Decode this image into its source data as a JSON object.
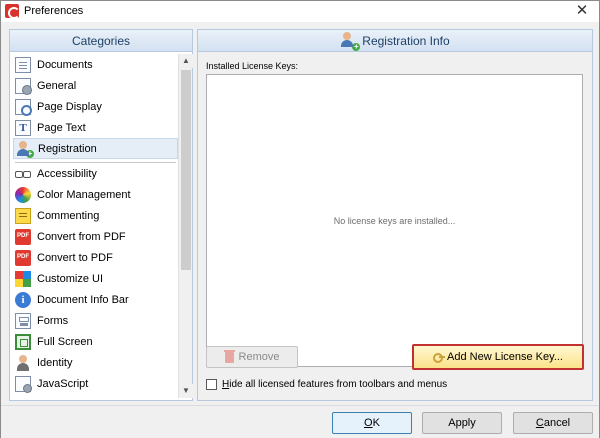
{
  "window": {
    "title": "Preferences",
    "close_glyph": "✕"
  },
  "categories": {
    "header": "Categories",
    "items": [
      {
        "label": "Documents",
        "icon": "document-icon"
      },
      {
        "label": "General",
        "icon": "general-settings-icon"
      },
      {
        "label": "Page Display",
        "icon": "page-display-icon"
      },
      {
        "label": "Page Text",
        "icon": "page-text-icon"
      },
      {
        "label": "Registration",
        "icon": "registration-icon",
        "selected": true
      },
      {
        "label": "Accessibility",
        "icon": "accessibility-glasses-icon"
      },
      {
        "label": "Color Management",
        "icon": "color-wheel-icon"
      },
      {
        "label": "Commenting",
        "icon": "comment-note-icon"
      },
      {
        "label": "Convert from PDF",
        "icon": "convert-from-pdf-icon"
      },
      {
        "label": "Convert to PDF",
        "icon": "convert-to-pdf-icon"
      },
      {
        "label": "Customize UI",
        "icon": "customize-ui-icon"
      },
      {
        "label": "Document Info Bar",
        "icon": "info-icon"
      },
      {
        "label": "Forms",
        "icon": "forms-icon"
      },
      {
        "label": "Full Screen",
        "icon": "full-screen-icon"
      },
      {
        "label": "Identity",
        "icon": "identity-person-icon"
      },
      {
        "label": "JavaScript",
        "icon": "javascript-icon"
      }
    ]
  },
  "registration": {
    "header": "Registration Info",
    "installed_label": "Installed License Keys:",
    "empty_message": "No license keys are installed...",
    "remove_label": "Remove",
    "add_label": "Add New License Key...",
    "hide_label_first": "H",
    "hide_label_rest": "ide all licensed features from toolbars and menus",
    "hide_checked": false
  },
  "footer": {
    "ok_u": "O",
    "ok_rest": "K",
    "apply_label": "Apply",
    "cancel_u": "C",
    "cancel_rest": "ancel"
  },
  "colors": {
    "header_text": "#1e3f66",
    "highlight_border": "#c23030",
    "add_button_fill": "#fbe38a"
  }
}
